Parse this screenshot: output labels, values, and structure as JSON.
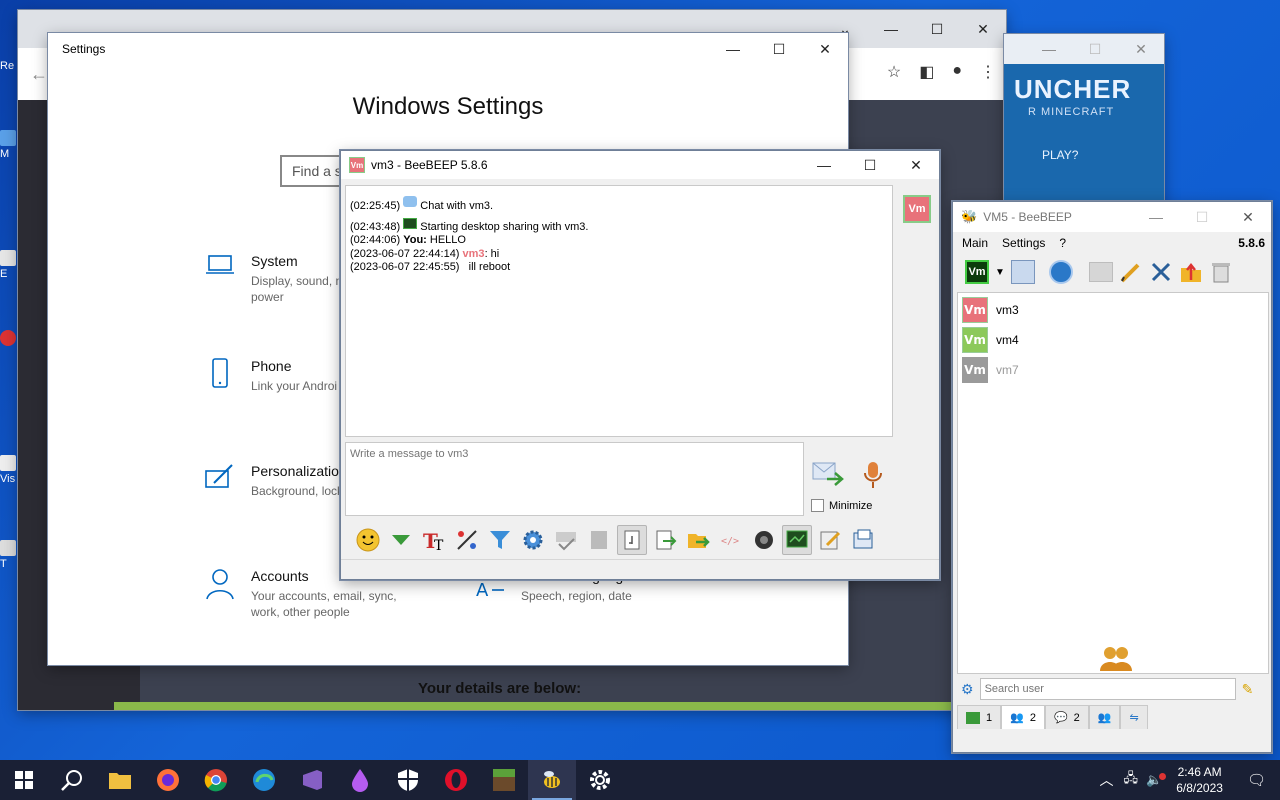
{
  "desktop": {
    "labels": [
      "Re",
      "M",
      "E",
      "Em\nD",
      "Vis",
      "T"
    ]
  },
  "chrome": {
    "details_text": "Your details are below:"
  },
  "launcher": {
    "title": "UNCHER",
    "subtitle": "R MINECRAFT",
    "play": "PLAY?"
  },
  "settings": {
    "window_title": "Settings",
    "heading": "Windows Settings",
    "search_placeholder": "Find a s",
    "categories": [
      {
        "title": "System",
        "subtitle": "Display, sound, n\npower"
      },
      {
        "title": "Phone",
        "subtitle": "Link your Androi"
      },
      {
        "title": "Personalization",
        "subtitle": "Background, lock"
      },
      {
        "title": "Accounts",
        "subtitle": "Your accounts, email, sync,\nwork, other people"
      },
      {
        "title": "Time & Language",
        "subtitle": "Speech, region, date"
      }
    ]
  },
  "chat": {
    "window_title": "vm3 - BeeBEEP 5.8.6",
    "avatar_label": "Vm",
    "messages": [
      {
        "time": "(02:25:45)",
        "text": "Chat with vm3.",
        "icon": "chat-bubble"
      },
      {
        "time": "(02:43:48)",
        "text": "Starting desktop sharing with vm3.",
        "icon": "desktop"
      },
      {
        "time": "(02:44:06)",
        "sender": "You:",
        "text": "HELLO"
      },
      {
        "time": "(2023-06-07 22:44:14)",
        "sender": "vm3",
        "text": ": hi"
      },
      {
        "time": "(2023-06-07 22:45:55)",
        "text": "ill reboot"
      }
    ],
    "input_placeholder": "Write a message to vm3",
    "minimize_label": "Minimize",
    "accent_color": "#e8727a"
  },
  "main": {
    "window_title": "VM5 - BeeBEEP",
    "menu": [
      "Main",
      "Settings",
      "?"
    ],
    "version": "5.8.6",
    "users": [
      {
        "name": "vm3",
        "avatar": "Vm",
        "color": "#e8727a",
        "online": true
      },
      {
        "name": "vm4",
        "avatar": "Vm",
        "color": "#8cc95a",
        "online": true
      },
      {
        "name": "vm7",
        "avatar": "Vm",
        "color": "#9a9a9a",
        "online": false
      }
    ],
    "search_placeholder": "Search user",
    "tabs": [
      {
        "count": "1"
      },
      {
        "count": "2"
      },
      {
        "count": "2"
      },
      {
        "count": ""
      },
      {
        "count": ""
      }
    ]
  },
  "taskbar": {
    "apps": [
      "windows-start",
      "search",
      "file-explorer",
      "firefox",
      "chrome",
      "edge",
      "visual-studio",
      "paint-drop",
      "security",
      "opera",
      "minecraft",
      "beebeep",
      "settings"
    ],
    "time": "2:46 AM",
    "date": "6/8/2023"
  }
}
